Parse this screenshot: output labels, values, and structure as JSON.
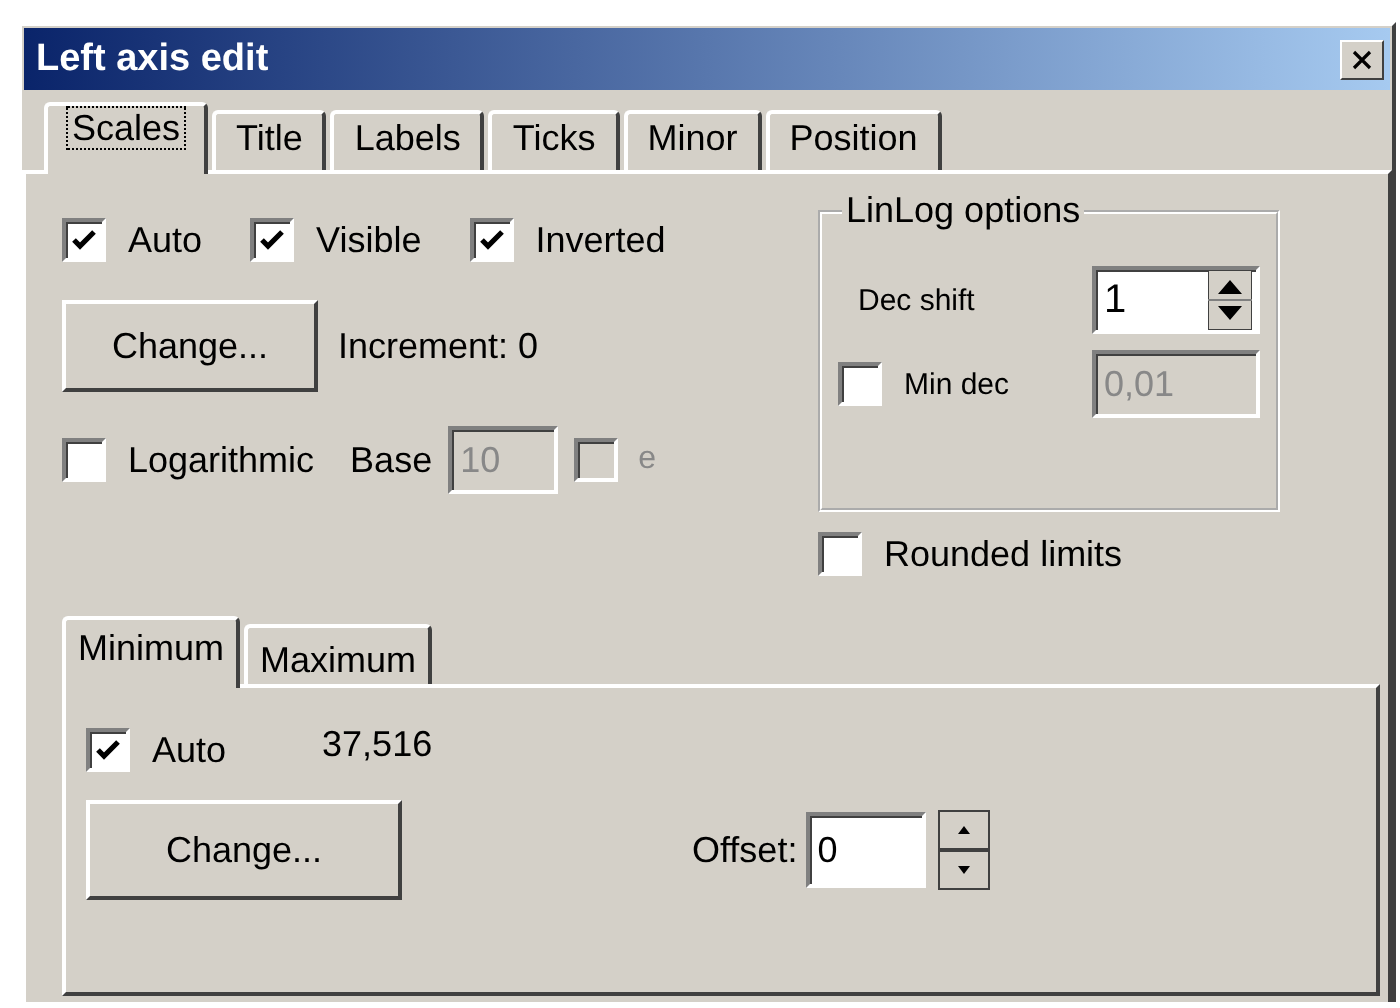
{
  "window": {
    "title": "Left axis edit"
  },
  "tabs": [
    {
      "label": "Scales",
      "selected": true
    },
    {
      "label": "Title",
      "selected": false
    },
    {
      "label": "Labels",
      "selected": false
    },
    {
      "label": "Ticks",
      "selected": false
    },
    {
      "label": "Minor",
      "selected": false
    },
    {
      "label": "Position",
      "selected": false
    }
  ],
  "scales": {
    "options": [
      {
        "label": "Auto",
        "checked": true
      },
      {
        "label": "Visible",
        "checked": true
      },
      {
        "label": "Inverted",
        "checked": true
      }
    ],
    "change_button": "Change...",
    "increment": "Increment:  0",
    "logarithmic": {
      "label": "Logarithmic",
      "checked": false
    },
    "base": {
      "label": "Base",
      "value": "10",
      "disabled": true
    },
    "e_option": {
      "label": "e",
      "checked": false,
      "disabled": true
    }
  },
  "linlog": {
    "title": "LinLog options",
    "dec_shift": {
      "label": "Dec shift",
      "value": "1"
    },
    "min_dec": {
      "label": "Min dec",
      "checked": false,
      "value": "0,01",
      "disabled": true
    }
  },
  "rounded_limits": {
    "label": "Rounded limits",
    "checked": false
  },
  "limit_tabs": [
    {
      "label": "Minimum",
      "selected": true
    },
    {
      "label": "Maximum",
      "selected": false
    }
  ],
  "limit": {
    "auto": {
      "label": "Auto",
      "checked": true
    },
    "value": "37,516",
    "change_button": "Change...",
    "offset": {
      "label": "Offset:",
      "value": "0"
    }
  }
}
